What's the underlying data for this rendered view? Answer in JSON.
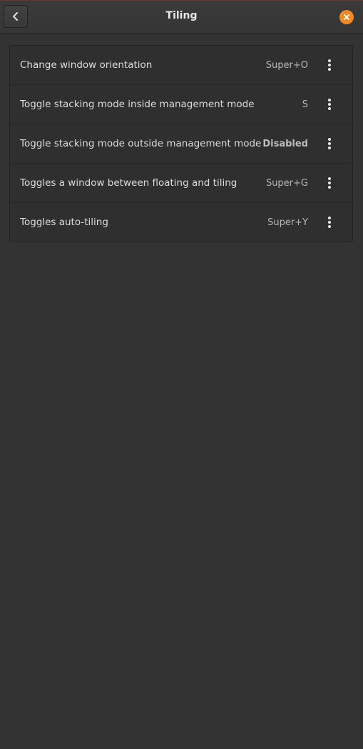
{
  "header": {
    "title": "Tiling",
    "back_icon": "chevron-left-icon",
    "close_icon": "close-icon",
    "close_color": "#f08a24"
  },
  "shortcuts": [
    {
      "label": "Change window orientation",
      "shortcut": "Super+O",
      "menu_icon": "more-vertical-icon"
    },
    {
      "label": "Toggle stacking mode inside management mode",
      "shortcut": "S",
      "menu_icon": "more-vertical-icon"
    },
    {
      "label": "Toggle stacking mode outside management mode",
      "shortcut": "Disabled",
      "menu_icon": "more-vertical-icon"
    },
    {
      "label": "Toggles a window between floating and tiling",
      "shortcut": "Super+G",
      "menu_icon": "more-vertical-icon"
    },
    {
      "label": "Toggles auto-tiling",
      "shortcut": "Super+Y",
      "menu_icon": "more-vertical-icon"
    }
  ]
}
